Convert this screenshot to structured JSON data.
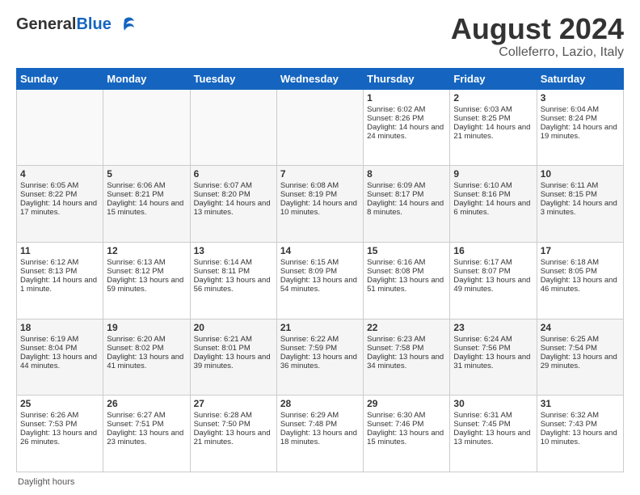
{
  "header": {
    "logo_general": "General",
    "logo_blue": "Blue",
    "title": "August 2024",
    "location": "Colleferro, Lazio, Italy"
  },
  "days_of_week": [
    "Sunday",
    "Monday",
    "Tuesday",
    "Wednesday",
    "Thursday",
    "Friday",
    "Saturday"
  ],
  "weeks": [
    [
      {
        "day": "",
        "sunrise": "",
        "sunset": "",
        "daylight": ""
      },
      {
        "day": "",
        "sunrise": "",
        "sunset": "",
        "daylight": ""
      },
      {
        "day": "",
        "sunrise": "",
        "sunset": "",
        "daylight": ""
      },
      {
        "day": "",
        "sunrise": "",
        "sunset": "",
        "daylight": ""
      },
      {
        "day": "1",
        "sunrise": "Sunrise: 6:02 AM",
        "sunset": "Sunset: 8:26 PM",
        "daylight": "Daylight: 14 hours and 24 minutes."
      },
      {
        "day": "2",
        "sunrise": "Sunrise: 6:03 AM",
        "sunset": "Sunset: 8:25 PM",
        "daylight": "Daylight: 14 hours and 21 minutes."
      },
      {
        "day": "3",
        "sunrise": "Sunrise: 6:04 AM",
        "sunset": "Sunset: 8:24 PM",
        "daylight": "Daylight: 14 hours and 19 minutes."
      }
    ],
    [
      {
        "day": "4",
        "sunrise": "Sunrise: 6:05 AM",
        "sunset": "Sunset: 8:22 PM",
        "daylight": "Daylight: 14 hours and 17 minutes."
      },
      {
        "day": "5",
        "sunrise": "Sunrise: 6:06 AM",
        "sunset": "Sunset: 8:21 PM",
        "daylight": "Daylight: 14 hours and 15 minutes."
      },
      {
        "day": "6",
        "sunrise": "Sunrise: 6:07 AM",
        "sunset": "Sunset: 8:20 PM",
        "daylight": "Daylight: 14 hours and 13 minutes."
      },
      {
        "day": "7",
        "sunrise": "Sunrise: 6:08 AM",
        "sunset": "Sunset: 8:19 PM",
        "daylight": "Daylight: 14 hours and 10 minutes."
      },
      {
        "day": "8",
        "sunrise": "Sunrise: 6:09 AM",
        "sunset": "Sunset: 8:17 PM",
        "daylight": "Daylight: 14 hours and 8 minutes."
      },
      {
        "day": "9",
        "sunrise": "Sunrise: 6:10 AM",
        "sunset": "Sunset: 8:16 PM",
        "daylight": "Daylight: 14 hours and 6 minutes."
      },
      {
        "day": "10",
        "sunrise": "Sunrise: 6:11 AM",
        "sunset": "Sunset: 8:15 PM",
        "daylight": "Daylight: 14 hours and 3 minutes."
      }
    ],
    [
      {
        "day": "11",
        "sunrise": "Sunrise: 6:12 AM",
        "sunset": "Sunset: 8:13 PM",
        "daylight": "Daylight: 14 hours and 1 minute."
      },
      {
        "day": "12",
        "sunrise": "Sunrise: 6:13 AM",
        "sunset": "Sunset: 8:12 PM",
        "daylight": "Daylight: 13 hours and 59 minutes."
      },
      {
        "day": "13",
        "sunrise": "Sunrise: 6:14 AM",
        "sunset": "Sunset: 8:11 PM",
        "daylight": "Daylight: 13 hours and 56 minutes."
      },
      {
        "day": "14",
        "sunrise": "Sunrise: 6:15 AM",
        "sunset": "Sunset: 8:09 PM",
        "daylight": "Daylight: 13 hours and 54 minutes."
      },
      {
        "day": "15",
        "sunrise": "Sunrise: 6:16 AM",
        "sunset": "Sunset: 8:08 PM",
        "daylight": "Daylight: 13 hours and 51 minutes."
      },
      {
        "day": "16",
        "sunrise": "Sunrise: 6:17 AM",
        "sunset": "Sunset: 8:07 PM",
        "daylight": "Daylight: 13 hours and 49 minutes."
      },
      {
        "day": "17",
        "sunrise": "Sunrise: 6:18 AM",
        "sunset": "Sunset: 8:05 PM",
        "daylight": "Daylight: 13 hours and 46 minutes."
      }
    ],
    [
      {
        "day": "18",
        "sunrise": "Sunrise: 6:19 AM",
        "sunset": "Sunset: 8:04 PM",
        "daylight": "Daylight: 13 hours and 44 minutes."
      },
      {
        "day": "19",
        "sunrise": "Sunrise: 6:20 AM",
        "sunset": "Sunset: 8:02 PM",
        "daylight": "Daylight: 13 hours and 41 minutes."
      },
      {
        "day": "20",
        "sunrise": "Sunrise: 6:21 AM",
        "sunset": "Sunset: 8:01 PM",
        "daylight": "Daylight: 13 hours and 39 minutes."
      },
      {
        "day": "21",
        "sunrise": "Sunrise: 6:22 AM",
        "sunset": "Sunset: 7:59 PM",
        "daylight": "Daylight: 13 hours and 36 minutes."
      },
      {
        "day": "22",
        "sunrise": "Sunrise: 6:23 AM",
        "sunset": "Sunset: 7:58 PM",
        "daylight": "Daylight: 13 hours and 34 minutes."
      },
      {
        "day": "23",
        "sunrise": "Sunrise: 6:24 AM",
        "sunset": "Sunset: 7:56 PM",
        "daylight": "Daylight: 13 hours and 31 minutes."
      },
      {
        "day": "24",
        "sunrise": "Sunrise: 6:25 AM",
        "sunset": "Sunset: 7:54 PM",
        "daylight": "Daylight: 13 hours and 29 minutes."
      }
    ],
    [
      {
        "day": "25",
        "sunrise": "Sunrise: 6:26 AM",
        "sunset": "Sunset: 7:53 PM",
        "daylight": "Daylight: 13 hours and 26 minutes."
      },
      {
        "day": "26",
        "sunrise": "Sunrise: 6:27 AM",
        "sunset": "Sunset: 7:51 PM",
        "daylight": "Daylight: 13 hours and 23 minutes."
      },
      {
        "day": "27",
        "sunrise": "Sunrise: 6:28 AM",
        "sunset": "Sunset: 7:50 PM",
        "daylight": "Daylight: 13 hours and 21 minutes."
      },
      {
        "day": "28",
        "sunrise": "Sunrise: 6:29 AM",
        "sunset": "Sunset: 7:48 PM",
        "daylight": "Daylight: 13 hours and 18 minutes."
      },
      {
        "day": "29",
        "sunrise": "Sunrise: 6:30 AM",
        "sunset": "Sunset: 7:46 PM",
        "daylight": "Daylight: 13 hours and 15 minutes."
      },
      {
        "day": "30",
        "sunrise": "Sunrise: 6:31 AM",
        "sunset": "Sunset: 7:45 PM",
        "daylight": "Daylight: 13 hours and 13 minutes."
      },
      {
        "day": "31",
        "sunrise": "Sunrise: 6:32 AM",
        "sunset": "Sunset: 7:43 PM",
        "daylight": "Daylight: 13 hours and 10 minutes."
      }
    ]
  ],
  "footer": {
    "note": "Daylight hours"
  }
}
